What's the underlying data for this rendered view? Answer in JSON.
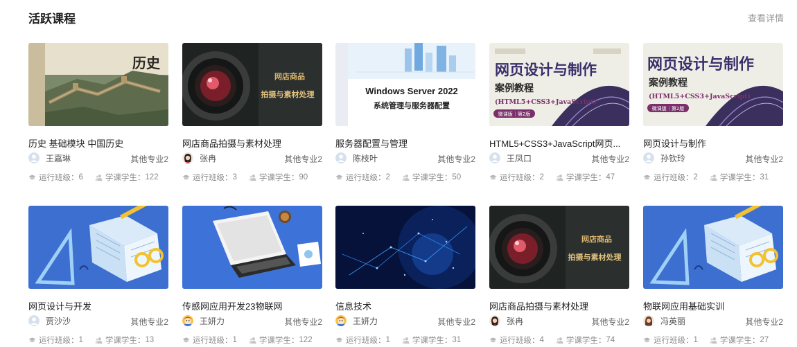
{
  "section": {
    "title": "活跃课程",
    "more_label": "查看详情"
  },
  "stat_labels": {
    "classes": "运行班级：",
    "students": "学课学生："
  },
  "covers": {
    "history": {
      "text": "历史"
    },
    "photo": {
      "line1": "网店商品",
      "line2": "拍摄与素材处理"
    },
    "server": {
      "line1": "Windows Server 2022",
      "line2": "系统管理与服务器配置"
    },
    "web": {
      "line1": "网页设计与制作",
      "line2": "案例教程",
      "line3": "(HTML5+CSS3+JavaScript)",
      "badge": "微课版｜第2版"
    }
  },
  "courses": [
    {
      "title": "历史 基础模块 中国历史",
      "teacher": "王嘉琳",
      "major": "其他专业2",
      "classes": "6",
      "students": "122",
      "cover": "history",
      "avatar": "default"
    },
    {
      "title": "网店商品拍摄与素材处理",
      "teacher": "张冉",
      "major": "其他专业2",
      "classes": "3",
      "students": "90",
      "cover": "photo",
      "avatar": "girl"
    },
    {
      "title": "服务器配置与管理",
      "teacher": "陈枝叶",
      "major": "其他专业2",
      "classes": "2",
      "students": "50",
      "cover": "server",
      "avatar": "default"
    },
    {
      "title": "HTML5+CSS3+JavaScript网页...",
      "teacher": "王凤口",
      "major": "其他专业2",
      "classes": "2",
      "students": "47",
      "cover": "web",
      "avatar": "default"
    },
    {
      "title": "网页设计与制作",
      "teacher": "孙钦玲",
      "major": "其他专业2",
      "classes": "2",
      "students": "31",
      "cover": "web2",
      "avatar": "default"
    },
    {
      "title": "网页设计与开发",
      "teacher": "贾沙沙",
      "major": "其他专业2",
      "classes": "1",
      "students": "13",
      "cover": "notebook",
      "avatar": "default"
    },
    {
      "title": "传感网应用开发23物联网",
      "teacher": "王妍力",
      "major": "其他专业2",
      "classes": "1",
      "students": "122",
      "cover": "laptop",
      "avatar": "cartoon"
    },
    {
      "title": "信息技术",
      "teacher": "王妍力",
      "major": "其他专业2",
      "classes": "1",
      "students": "31",
      "cover": "tech",
      "avatar": "cartoon"
    },
    {
      "title": "网店商品拍摄与素材处理",
      "teacher": "张冉",
      "major": "其他专业2",
      "classes": "4",
      "students": "74",
      "cover": "photo",
      "avatar": "girl"
    },
    {
      "title": "物联网应用基础实训",
      "teacher": "冯英丽",
      "major": "其他专业2",
      "classes": "1",
      "students": "27",
      "cover": "notebook",
      "avatar": "woman"
    }
  ]
}
